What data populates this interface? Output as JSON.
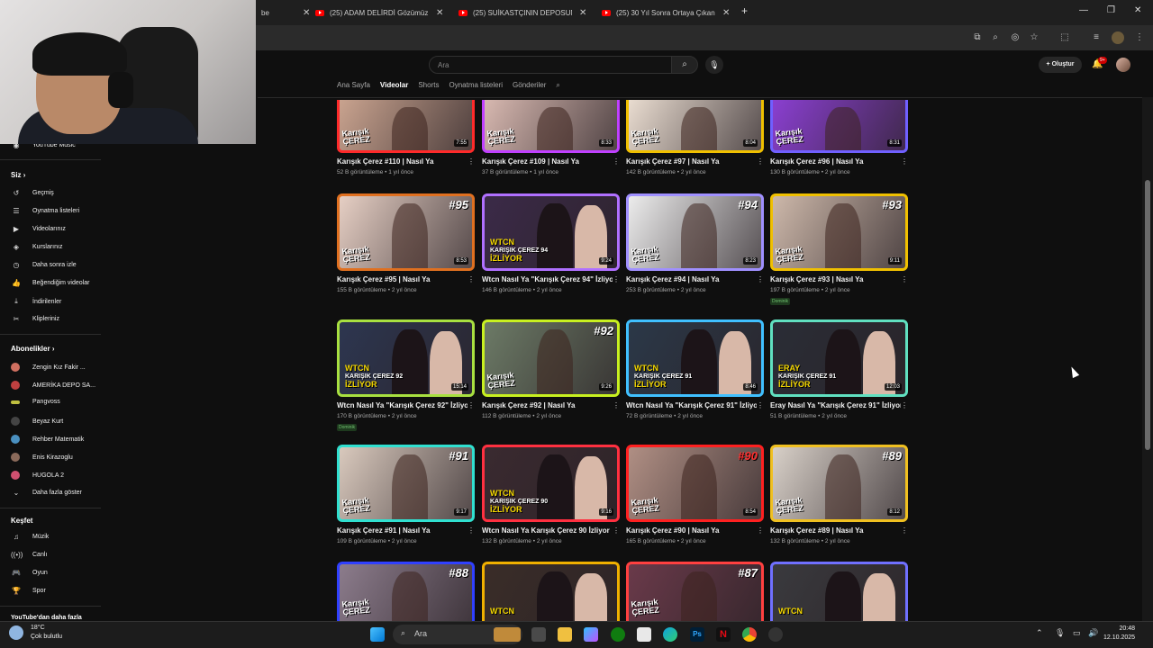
{
  "browser": {
    "tabs": [
      {
        "title": "be",
        "partial": true
      },
      {
        "title": "(25) ADAM DELİRDİ Gözümüz"
      },
      {
        "title": "(25) SUİKASTÇININ DEPOSUNU"
      },
      {
        "title": "(25) 30 Yıl Sonra Ortaya Çıkan"
      }
    ],
    "new_tab": "+",
    "window_controls": [
      "—",
      "❐",
      "✕"
    ]
  },
  "header": {
    "search_placeholder": "Ara",
    "create_label": "Oluştur",
    "notifications_badge": "9+"
  },
  "channel_tabs": [
    {
      "label": "Ana Sayfa",
      "active": false
    },
    {
      "label": "Videolar",
      "active": true
    },
    {
      "label": "Shorts",
      "active": false
    },
    {
      "label": "Oynatma listeleri",
      "active": false
    },
    {
      "label": "Gönderiler",
      "active": false
    }
  ],
  "sidebar": {
    "top_item": "YouTube Music",
    "you_heading": "Siz",
    "you_items": [
      "Geçmiş",
      "Oynatma listeleri",
      "Videolarınız",
      "Kurslarınız",
      "Daha sonra izle",
      "Beğendiğim videolar",
      "İndirilenler",
      "Klipleriniz"
    ],
    "subs_heading": "Abonelikler",
    "subs": [
      "Zengin Kız Fakir ...",
      "AMERİKA DEPO SA...",
      "Pangvoss",
      "Beyaz Kurt",
      "Rehber Matematik",
      "Enis Kirazoglu",
      "HUGOLA 2"
    ],
    "show_more": "Daha fazla göster",
    "explore_heading": "Keşfet",
    "explore_items": [
      "Müzik",
      "Canlı",
      "Oyun",
      "Spor"
    ],
    "more_from": "YouTube'dan daha fazla"
  },
  "videos": [
    {
      "title": "Karışık Çerez #110 | Nasıl Ya",
      "views": "52 B görüntüleme",
      "age": "1 yıl önce",
      "duration": "7:55",
      "border": "#ff2a2a",
      "bg": "#c9a38f",
      "style": "brand"
    },
    {
      "title": "Karışık Çerez #109 | Nasıl Ya",
      "views": "37 B görüntüleme",
      "age": "1 yıl önce",
      "duration": "8:33",
      "border": "#c040ff",
      "bg": "#d7b8b0",
      "style": "brand"
    },
    {
      "title": "Karışık Çerez #97 | Nasıl Ya",
      "views": "142 B görüntüleme",
      "age": "2 yıl önce",
      "duration": "8:04",
      "border": "#f0c000",
      "bg": "#e9dcd0",
      "style": "brand"
    },
    {
      "title": "Karışık Çerez #96 | Nasıl Ya",
      "views": "130 B görüntüleme",
      "age": "2 yıl önce",
      "duration": "8:31",
      "border": "#7060ff",
      "bg": "#8a3fd0",
      "style": "brand"
    },
    {
      "title": "Karışık Çerez #95 | Nasıl Ya",
      "views": "155 B görüntüleme",
      "age": "2 yıl önce",
      "duration": "8:53",
      "border": "#e07020",
      "bg": "#e6cfc4",
      "style": "brand",
      "num": "#95"
    },
    {
      "title": "Wtcn Nasıl Ya \"Karışık Çerez 94\" İzliyor",
      "views": "146 B görüntüleme",
      "age": "2 yıl önce",
      "duration": "9:24",
      "border": "#b070ff",
      "bg": "#3b2a48",
      "style": "wtcn",
      "cap1": "WTCN",
      "cap2": "KARIŞIK ÇEREZ 94",
      "cap3": "İZLİYOR"
    },
    {
      "title": "Karışık Çerez #94 | Nasıl Ya",
      "views": "253 B görüntüleme",
      "age": "2 yıl önce",
      "duration": "8:23",
      "border": "#a090ff",
      "bg": "#ececec",
      "style": "brand",
      "num": "#94"
    },
    {
      "title": "Karışık Çerez #93 | Nasıl Ya",
      "views": "197 B görüntüleme",
      "age": "2 yıl önce",
      "duration": "9:11",
      "border": "#f0c000",
      "bg": "#cdb8aa",
      "style": "brand",
      "num": "#93",
      "tag": "Dominik"
    },
    {
      "title": "Wtcn Nasıl Ya \"Karışık Çerez 92\" İzliyor",
      "views": "170 B görüntüleme",
      "age": "2 yıl önce",
      "duration": "15:14",
      "border": "#a8e040",
      "bg": "#2d3650",
      "style": "wtcn",
      "cap1": "WTCN",
      "cap2": "KARIŞIK ÇEREZ 92",
      "cap3": "İZLİYOR",
      "tag": "Dominik"
    },
    {
      "title": "Karışık Çerez #92 | Nasıl Ya",
      "views": "112 B görüntüleme",
      "age": "2 yıl önce",
      "duration": "9:26",
      "border": "#c8f020",
      "bg": "#6c7a66",
      "style": "brand",
      "num": "#92"
    },
    {
      "title": "Wtcn Nasıl Ya \"Karışık Çerez 91\" İzliyor",
      "views": "72 B görüntüleme",
      "age": "2 yıl önce",
      "duration": "8:46",
      "border": "#40c0ff",
      "bg": "#2b3848",
      "style": "wtcn",
      "cap1": "WTCN",
      "cap2": "KARIŞIK ÇEREZ 91",
      "cap3": "İZLİYOR"
    },
    {
      "title": "Eray Nasıl Ya \"Karışık Çerez 91\" İzliyor",
      "views": "51 B görüntüleme",
      "age": "2 yıl önce",
      "duration": "12:03",
      "border": "#60e0c0",
      "bg": "#2a2d36",
      "style": "wtcn",
      "cap1": "ERAY",
      "cap2": "KARIŞIK ÇEREZ 91",
      "cap3": "İZLİYOR"
    },
    {
      "title": "Karışık Çerez #91 | Nasıl Ya",
      "views": "109 B görüntüleme",
      "age": "2 yıl önce",
      "duration": "9:17",
      "border": "#30e0d0",
      "bg": "#d9c9bd",
      "style": "brand",
      "num": "#91"
    },
    {
      "title": "Wtcn Nasıl Ya Karışık Çerez 90 İzliyor",
      "views": "132 B görüntüleme",
      "age": "2 yıl önce",
      "duration": "9:16",
      "border": "#ff3040",
      "bg": "#3a2a30",
      "style": "wtcn",
      "cap1": "WTCN",
      "cap2": "KARIŞIK ÇEREZ 90",
      "cap3": "İZLİYOR"
    },
    {
      "title": "Karışık Çerez #90 | Nasıl Ya",
      "views": "165 B görüntüleme",
      "age": "2 yıl önce",
      "duration": "8:54",
      "border": "#ff2020",
      "bg": "#b08f84",
      "style": "brand",
      "num": "#90"
    },
    {
      "title": "Karışık Çerez #89 | Nasıl Ya",
      "views": "132 B görüntüleme",
      "age": "2 yıl önce",
      "duration": "8:12",
      "border": "#f0c020",
      "bg": "#d8d0c8",
      "style": "brand",
      "num": "#89"
    },
    {
      "title": "",
      "views": "",
      "age": "",
      "duration": "",
      "border": "#3040ff",
      "bg": "#8c7c8c",
      "style": "brand",
      "num": "#88"
    },
    {
      "title": "",
      "views": "",
      "age": "",
      "duration": "",
      "border": "#f0b000",
      "bg": "#3a2d28",
      "style": "wtcn",
      "cap1": "WTCN"
    },
    {
      "title": "",
      "views": "",
      "age": "",
      "duration": "",
      "border": "#ff4040",
      "bg": "#6a3a4a",
      "style": "brand",
      "num": "#87"
    },
    {
      "title": "",
      "views": "",
      "age": "",
      "duration": "",
      "border": "#7070ff",
      "bg": "#3a3a3e",
      "style": "wtcn",
      "cap1": "WTCN"
    }
  ],
  "thumb_brand": "Karışık\nÇEREZ",
  "taskbar": {
    "weather_temp": "18°C",
    "weather_desc": "Çok bulutlu",
    "search_label": "Ara",
    "time": "20:48",
    "date": "12.10.2025"
  }
}
